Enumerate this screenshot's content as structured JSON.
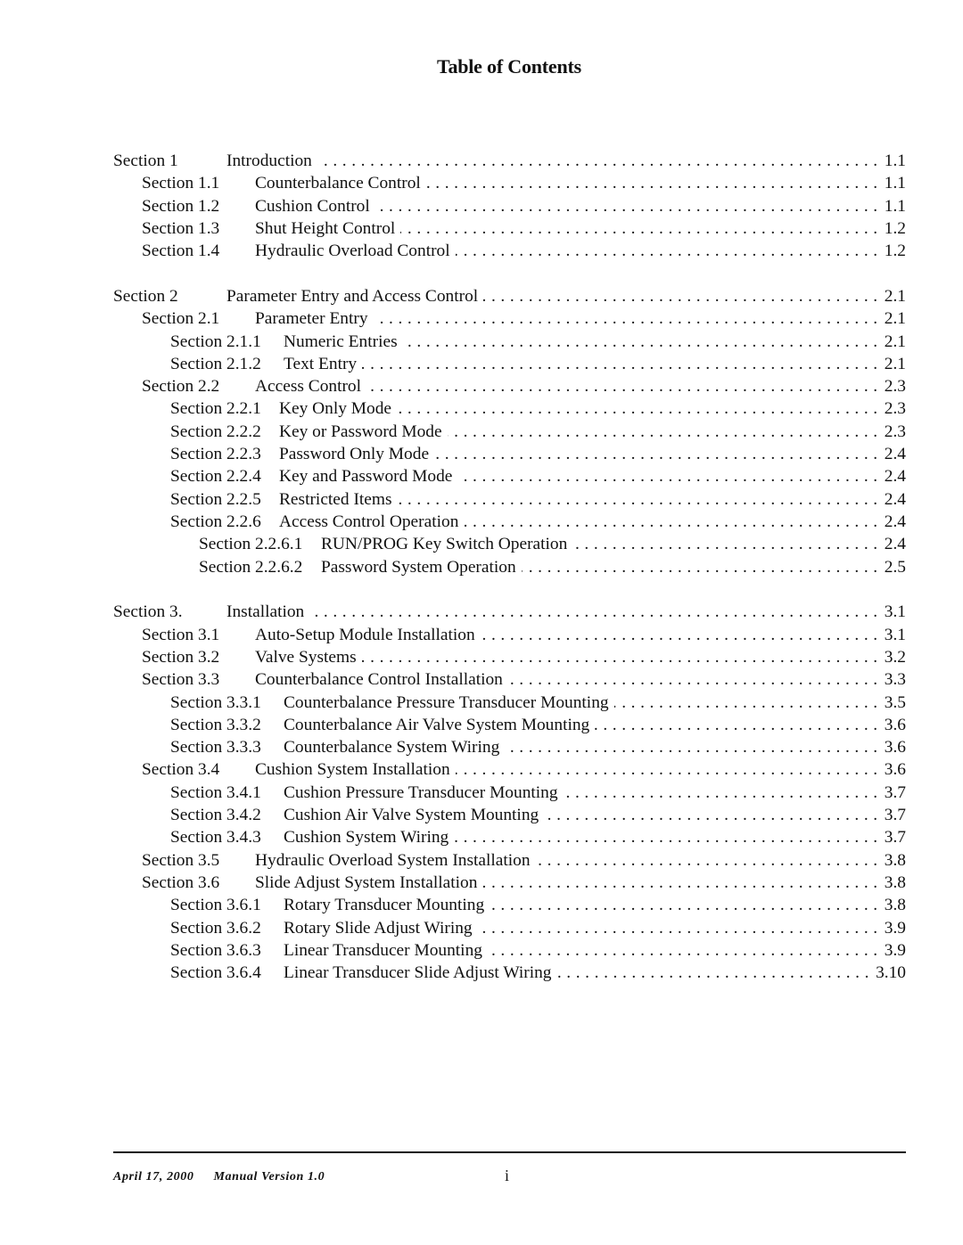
{
  "title": "Table of Contents",
  "groups": [
    {
      "entries": [
        {
          "level": 0,
          "section": "Section 1",
          "title": "Introduction",
          "page": "1.1"
        },
        {
          "level": 1,
          "section": "Section 1.1",
          "title": "Counterbalance Control",
          "page": "1.1"
        },
        {
          "level": 1,
          "section": "Section 1.2",
          "title": "Cushion Control",
          "page": "1.1"
        },
        {
          "level": 1,
          "section": "Section 1.3",
          "title": "Shut Height Control",
          "page": "1.2"
        },
        {
          "level": 1,
          "section": "Section 1.4",
          "title": "Hydraulic Overload Control",
          "page": "1.2"
        }
      ]
    },
    {
      "entries": [
        {
          "level": 0,
          "section": "Section 2",
          "title": "Parameter Entry and Access Control",
          "page": "2.1"
        },
        {
          "level": 1,
          "section": "Section 2.1",
          "title": "Parameter Entry",
          "page": "2.1"
        },
        {
          "level": 2,
          "section": "Section 2.1.1",
          "title": "Numeric Entries",
          "page": "2.1"
        },
        {
          "level": 2,
          "section": "Section 2.1.2",
          "title": "Text Entry",
          "page": "2.1"
        },
        {
          "level": 1,
          "section": "Section 2.2",
          "title": "Access Control",
          "page": "2.3"
        },
        {
          "level": 2,
          "section": "Section 2.2.1",
          "title": "Key Only Mode",
          "page": "2.3",
          "tight": true
        },
        {
          "level": 2,
          "section": "Section 2.2.2",
          "title": "Key or Password Mode",
          "page": "2.3",
          "tight": true
        },
        {
          "level": 2,
          "section": "Section 2.2.3",
          "title": "Password Only Mode",
          "page": "2.4",
          "tight": true
        },
        {
          "level": 2,
          "section": "Section 2.2.4",
          "title": "Key and Password Mode",
          "page": "2.4",
          "tight": true
        },
        {
          "level": 2,
          "section": "Section 2.2.5",
          "title": "Restricted Items",
          "page": "2.4",
          "tight": true
        },
        {
          "level": 2,
          "section": "Section 2.2.6",
          "title": "Access Control Operation",
          "page": "2.4",
          "tight": true
        },
        {
          "level": 3,
          "section": "Section 2.2.6.1",
          "title": "RUN/PROG Key Switch Operation",
          "page": "2.4"
        },
        {
          "level": 3,
          "section": "Section 2.2.6.2",
          "title": "Password System Operation",
          "page": "2.5"
        }
      ]
    },
    {
      "entries": [
        {
          "level": 0,
          "section": "Section 3.",
          "title": "Installation",
          "page": "3.1"
        },
        {
          "level": 1,
          "section": "Section 3.1",
          "title": "Auto-Setup Module Installation",
          "page": "3.1"
        },
        {
          "level": 1,
          "section": "Section 3.2",
          "title": "Valve Systems",
          "page": "3.2"
        },
        {
          "level": 1,
          "section": "Section 3.3",
          "title": "Counterbalance Control Installation",
          "page": "3.3"
        },
        {
          "level": 2,
          "section": "Section 3.3.1",
          "title": "Counterbalance Pressure Transducer Mounting",
          "page": "3.5"
        },
        {
          "level": 2,
          "section": "Section 3.3.2",
          "title": "Counterbalance Air Valve System Mounting",
          "page": "3.6"
        },
        {
          "level": 2,
          "section": "Section 3.3.3",
          "title": "Counterbalance System Wiring",
          "page": "3.6"
        },
        {
          "level": 1,
          "section": "Section 3.4",
          "title": "Cushion System Installation",
          "page": "3.6"
        },
        {
          "level": 2,
          "section": "Section 3.4.1",
          "title": "Cushion Pressure Transducer Mounting",
          "page": "3.7"
        },
        {
          "level": 2,
          "section": "Section 3.4.2",
          "title": "Cushion Air Valve System Mounting",
          "page": "3.7"
        },
        {
          "level": 2,
          "section": "Section 3.4.3",
          "title": "Cushion System Wiring",
          "page": "3.7"
        },
        {
          "level": 1,
          "section": "Section 3.5",
          "title": "Hydraulic Overload System Installation",
          "page": "3.8"
        },
        {
          "level": 1,
          "section": "Section 3.6",
          "title": "Slide Adjust System Installation",
          "page": "3.8"
        },
        {
          "level": 2,
          "section": "Section 3.6.1",
          "title": "Rotary Transducer Mounting",
          "page": "3.8"
        },
        {
          "level": 2,
          "section": "Section 3.6.2",
          "title": "Rotary Slide Adjust Wiring",
          "page": "3.9"
        },
        {
          "level": 2,
          "section": "Section 3.6.3",
          "title": "Linear Transducer Mounting",
          "page": "3.9"
        },
        {
          "level": 2,
          "section": "Section 3.6.4",
          "title": "Linear Transducer Slide Adjust Wiring",
          "page": "3.10"
        }
      ]
    }
  ],
  "footer": {
    "date": "April 17, 2000",
    "version": "Manual Version 1.0",
    "page_number": "i"
  }
}
